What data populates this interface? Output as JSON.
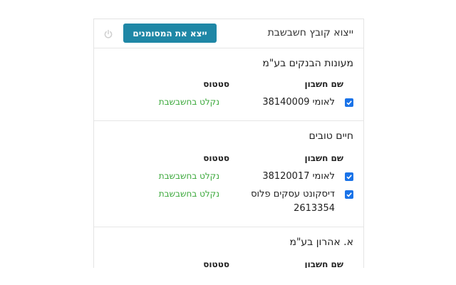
{
  "header": {
    "title": "ייצוא קובץ חשבשבת",
    "export_button_label": "ייצא את המסומנים",
    "power_icon": "power-icon"
  },
  "companies": [
    {
      "name": "מעונות הבנקים בע\"מ",
      "col_account": "שם חשבון",
      "col_status": "סטטוס",
      "rows": [
        {
          "account": "לאומי 38140009",
          "status": "נקלט בחשבשבת",
          "checked": true
        }
      ]
    },
    {
      "name": "חיים טובים",
      "col_account": "שם חשבון",
      "col_status": "סטטוס",
      "rows": [
        {
          "account": "לאומי 38120017",
          "status": "נקלט בחשבשבת",
          "checked": true
        },
        {
          "account": "דיסקונט עסקים פלוס 2613354",
          "status": "נקלט בחשבשבת",
          "checked": true
        }
      ]
    },
    {
      "name": "א. אהרון בע\"מ",
      "col_account": "שם חשבון",
      "col_status": "סטטוס",
      "rows": []
    }
  ],
  "colors": {
    "accent": "#1f87a6",
    "checkbox": "#1a73e8",
    "status_ok": "#3aa83a"
  }
}
